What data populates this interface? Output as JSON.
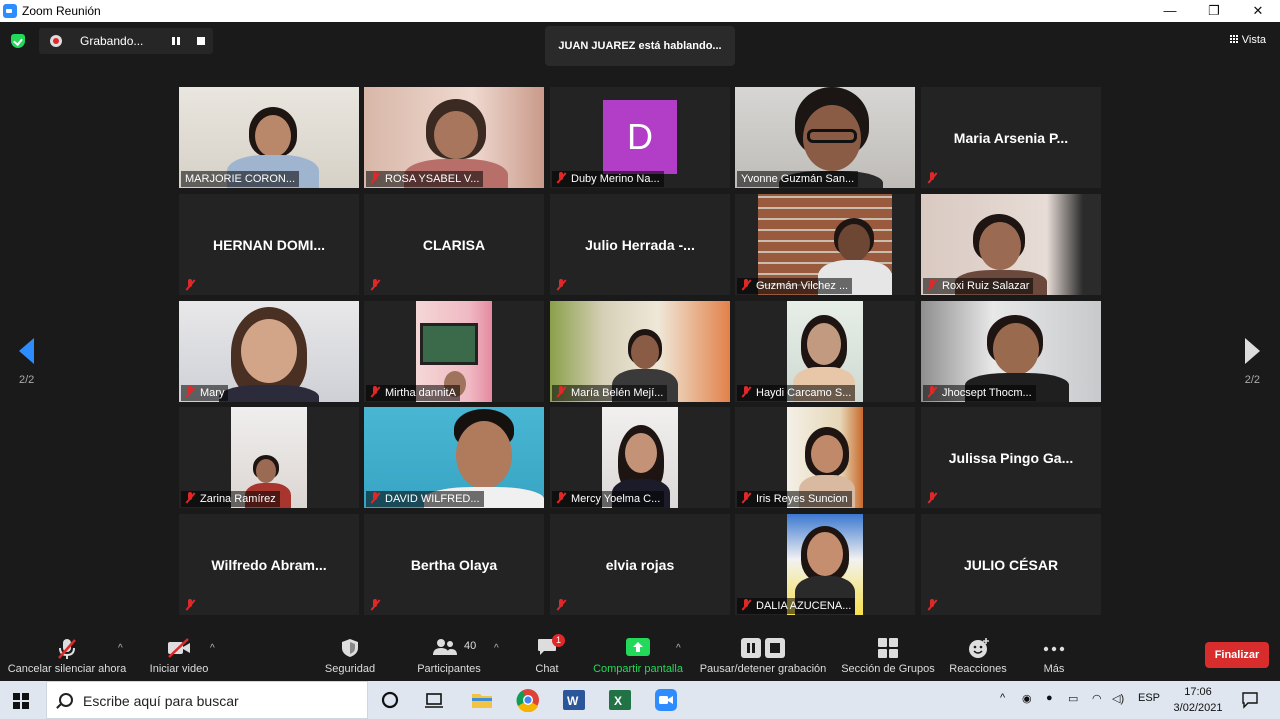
{
  "window": {
    "title": "Zoom Reunión",
    "controls": [
      "—",
      "❐",
      "✕"
    ]
  },
  "top": {
    "recording_label": "Grabando...",
    "speaking": "JUAN JUAREZ está hablando...",
    "view_label": "Vista"
  },
  "pager": {
    "left": "2/2",
    "right": "2/2"
  },
  "tiles": [
    {
      "name": "MARJORIE CORON...",
      "video": true,
      "muted": false
    },
    {
      "name": "ROSA  YSABEL V...",
      "video": true,
      "muted": true
    },
    {
      "name": "Duby Merino Na...",
      "video": false,
      "avatar": "D",
      "muted": true
    },
    {
      "name": "Yvonne Guzmán San...",
      "video": true,
      "muted": false
    },
    {
      "name": "Maria  Arsenia  P...",
      "video": false,
      "muted": true
    },
    {
      "name": "HERNAN  DOMI...",
      "video": false,
      "muted": true
    },
    {
      "name": "CLARISA",
      "video": false,
      "muted": true
    },
    {
      "name": "Julio  Herrada  -...",
      "video": false,
      "muted": true
    },
    {
      "name": "Guzmán Vilchez ...",
      "video": true,
      "muted": true
    },
    {
      "name": "Roxi Ruiz Salazar",
      "video": true,
      "muted": true
    },
    {
      "name": "Mary",
      "video": true,
      "muted": true
    },
    {
      "name": "Mirtha dannitA",
      "video": true,
      "muted": true
    },
    {
      "name": "María Belén Mejí...",
      "video": true,
      "muted": true
    },
    {
      "name": "Haydi Carcamo S...",
      "video": true,
      "muted": true
    },
    {
      "name": "Jhocsept Thocm...",
      "video": true,
      "muted": true
    },
    {
      "name": "Zarina Ramírez",
      "video": true,
      "muted": true
    },
    {
      "name": "DAVID WILFRED...",
      "video": true,
      "muted": true
    },
    {
      "name": "Mercy Yoelma C...",
      "video": true,
      "muted": true
    },
    {
      "name": "Iris Reyes Suncion",
      "video": true,
      "muted": true
    },
    {
      "name": "Julissa  Pingo  Ga...",
      "video": false,
      "muted": true
    },
    {
      "name": "Wilfredo  Abram...",
      "video": false,
      "muted": true
    },
    {
      "name": "Bertha Olaya",
      "video": false,
      "muted": true
    },
    {
      "name": "elvia rojas",
      "video": false,
      "muted": true
    },
    {
      "name": "DALIA  AZUCENA...",
      "video": true,
      "muted": true
    },
    {
      "name": "JULIO CÉSAR",
      "video": false,
      "muted": true
    }
  ],
  "toolbar": {
    "mute": "Cancelar silenciar ahora",
    "video": "Iniciar video",
    "security": "Seguridad",
    "participants": "Participantes",
    "participants_count": "40",
    "chat": "Chat",
    "chat_badge": "1",
    "share": "Compartir pantalla",
    "record": "Pausar/detener grabación",
    "breakout": "Sección de Grupos",
    "reactions": "Reacciones",
    "more": "Más",
    "end": "Finalizar"
  },
  "taskbar": {
    "search_placeholder": "Escribe aquí para buscar",
    "lang": "ESP",
    "time": "17:06",
    "date": "3/02/2021"
  },
  "colors": {
    "accent": "#2d8cff",
    "end": "#d92d2d",
    "share": "#23d959",
    "avatar_d": "#b23ec8"
  }
}
